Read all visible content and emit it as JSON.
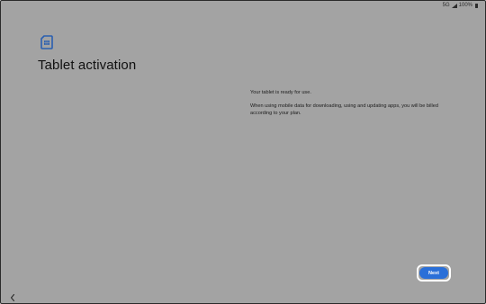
{
  "status_bar": {
    "network": "5G",
    "battery": "100%"
  },
  "page": {
    "title": "Tablet activation"
  },
  "content": {
    "line1": "Your tablet is ready for use.",
    "line2": "When using mobile data for downloading, using and updating apps, you will be billed according to your plan."
  },
  "actions": {
    "next_label": "Next"
  },
  "colors": {
    "background": "#a3a3a3",
    "accent": "#2a6fd8",
    "icon": "#2a5fb0"
  },
  "icons": {
    "header": "sim-card-icon",
    "nav_back": "back-chevron-icon"
  }
}
